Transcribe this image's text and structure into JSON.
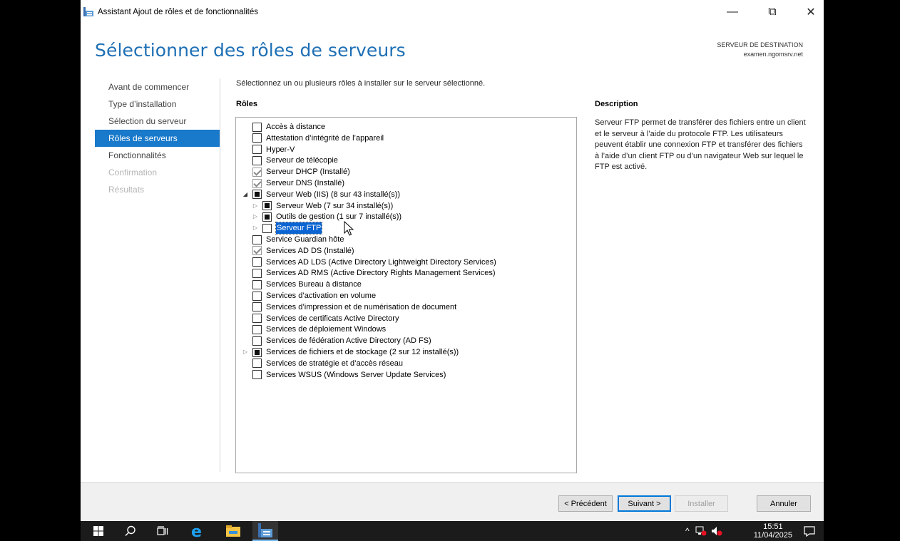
{
  "window": {
    "title": "Assistant Ajout de rôles et de fonctionnalités",
    "minimize": "—",
    "maximize": "⧉",
    "close": "✕"
  },
  "page": {
    "title": "Sélectionner des rôles de serveurs",
    "destination_label": "SERVEUR DE DESTINATION",
    "destination_server": "examen.ngomsrv.net"
  },
  "nav": {
    "items": [
      {
        "label": "Avant de commencer",
        "state": "normal"
      },
      {
        "label": "Type d’installation",
        "state": "normal"
      },
      {
        "label": "Sélection du serveur",
        "state": "normal"
      },
      {
        "label": "Rôles de serveurs",
        "state": "active"
      },
      {
        "label": "Fonctionnalités",
        "state": "normal"
      },
      {
        "label": "Confirmation",
        "state": "disabled"
      },
      {
        "label": "Résultats",
        "state": "disabled"
      }
    ]
  },
  "main": {
    "instruction": "Sélectionnez un ou plusieurs rôles à installer sur le serveur sélectionné.",
    "roles_header": "Rôles",
    "roles": [
      {
        "label": "Accès à distance",
        "state": "unchecked",
        "level": 0,
        "expander": ""
      },
      {
        "label": "Attestation d’intégrité de l’appareil",
        "state": "unchecked",
        "level": 0,
        "expander": ""
      },
      {
        "label": "Hyper-V",
        "state": "unchecked",
        "level": 0,
        "expander": ""
      },
      {
        "label": "Serveur de télécopie",
        "state": "unchecked",
        "level": 0,
        "expander": ""
      },
      {
        "label": "Serveur DHCP (Installé)",
        "state": "checked",
        "level": 0,
        "expander": ""
      },
      {
        "label": "Serveur DNS (Installé)",
        "state": "checked",
        "level": 0,
        "expander": ""
      },
      {
        "label": "Serveur Web (IIS) (8 sur 43 installé(s))",
        "state": "partial",
        "level": 0,
        "expander": "open"
      },
      {
        "label": "Serveur Web (7 sur 34 installé(s))",
        "state": "partial",
        "level": 1,
        "expander": "closed"
      },
      {
        "label": "Outils de gestion (1 sur 7 installé(s))",
        "state": "partial",
        "level": 1,
        "expander": "closed"
      },
      {
        "label": "Serveur FTP",
        "state": "unchecked",
        "level": 1,
        "expander": "closed",
        "selected": true
      },
      {
        "label": "Service Guardian hôte",
        "state": "unchecked",
        "level": 0,
        "expander": ""
      },
      {
        "label": "Services AD DS (Installé)",
        "state": "checked",
        "level": 0,
        "expander": ""
      },
      {
        "label": "Services AD LDS (Active Directory Lightweight Directory Services)",
        "state": "unchecked",
        "level": 0,
        "expander": ""
      },
      {
        "label": "Services AD RMS (Active Directory Rights Management Services)",
        "state": "unchecked",
        "level": 0,
        "expander": ""
      },
      {
        "label": "Services Bureau à distance",
        "state": "unchecked",
        "level": 0,
        "expander": ""
      },
      {
        "label": "Services d’activation en volume",
        "state": "unchecked",
        "level": 0,
        "expander": ""
      },
      {
        "label": "Services d’impression et de numérisation de document",
        "state": "unchecked",
        "level": 0,
        "expander": ""
      },
      {
        "label": "Services de certificats Active Directory",
        "state": "unchecked",
        "level": 0,
        "expander": ""
      },
      {
        "label": "Services de déploiement Windows",
        "state": "unchecked",
        "level": 0,
        "expander": ""
      },
      {
        "label": "Services de fédération Active Directory (AD FS)",
        "state": "unchecked",
        "level": 0,
        "expander": ""
      },
      {
        "label": "Services de fichiers et de stockage (2 sur 12 installé(s))",
        "state": "partial",
        "level": 0,
        "expander": "closed"
      },
      {
        "label": "Services de stratégie et d’accès réseau",
        "state": "unchecked",
        "level": 0,
        "expander": ""
      },
      {
        "label": "Services WSUS (Windows Server Update Services)",
        "state": "unchecked",
        "level": 0,
        "expander": ""
      }
    ],
    "description_header": "Description",
    "description_text": "Serveur FTP permet de transférer des fichiers entre un client et le serveur à l’aide du protocole FTP. Les utilisateurs peuvent établir une connexion FTP et transférer des fichiers à l’aide d’un client FTP ou d’un navigateur Web sur lequel le FTP est activé."
  },
  "footer": {
    "previous": "< Précédent",
    "next": "Suivant >",
    "install": "Installer",
    "cancel": "Annuler"
  },
  "taskbar": {
    "time": "15:51",
    "date": "11/04/2025",
    "tray_chevron": "^"
  },
  "colors": {
    "accent": "#1979ca",
    "title_blue": "#1e6fb5",
    "selection": "#0a64d2"
  }
}
